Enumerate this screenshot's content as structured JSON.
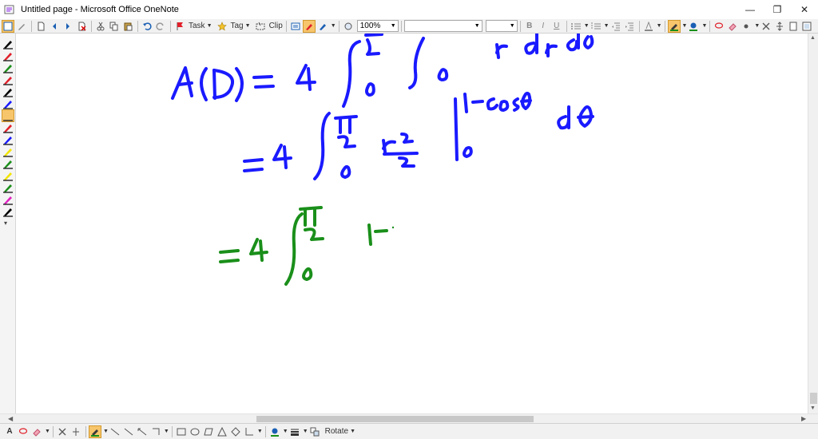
{
  "window": {
    "title": "Untitled page - Microsoft Office OneNote",
    "controls": {
      "minimize": "—",
      "restore": "❐",
      "close": "✕"
    }
  },
  "toolbar": {
    "task_label": "Task",
    "tag_label": "Tag",
    "clip_label": "Clip",
    "zoom_value": "100%",
    "font_value": "",
    "size_value": "",
    "bold": "B",
    "italic": "I",
    "underline": "U"
  },
  "bottom_toolbar": {
    "rotate_label": "Rotate"
  },
  "colors": {
    "ink_blue": "#1a1aff",
    "ink_green": "#1a8f1a",
    "active_tool": "#f7c56b",
    "pen_red": "#e0202a",
    "pen_yellow": "#f2e400",
    "pen_magenta": "#e020c0"
  },
  "pen_palette": [
    {
      "color": "#000000"
    },
    {
      "color": "#e0202a"
    },
    {
      "color": "#1a8f1a"
    },
    {
      "color": "#e0202a"
    },
    {
      "color": "#000000"
    },
    {
      "color": "#1a1aff"
    },
    {
      "color": "#f7c56b"
    },
    {
      "color": "#e0202a"
    },
    {
      "color": "#1a1aff"
    },
    {
      "color": "#f2e400"
    },
    {
      "color": "#1a8f1a"
    },
    {
      "color": "#f2e400"
    },
    {
      "color": "#1a8f1a"
    },
    {
      "color": "#e020c0"
    },
    {
      "color": "#000000"
    }
  ]
}
